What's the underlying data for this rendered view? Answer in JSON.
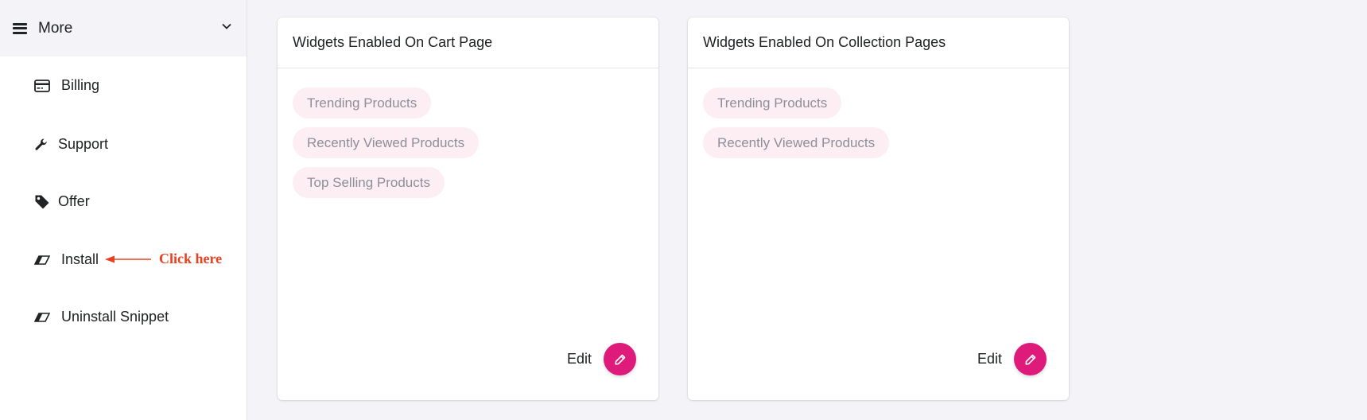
{
  "sidebar": {
    "header_label": "More",
    "items": [
      {
        "label": "Billing",
        "icon": "credit-card-icon"
      },
      {
        "label": "Support",
        "icon": "wrench-icon"
      },
      {
        "label": "Offer",
        "icon": "tag-icon"
      },
      {
        "label": "Install",
        "icon": "eraser-icon"
      },
      {
        "label": "Uninstall Snippet",
        "icon": "eraser-icon"
      }
    ]
  },
  "annotation": {
    "text": "Click here",
    "color": "#e8411f"
  },
  "cards": [
    {
      "title": "Widgets Enabled On Cart Page",
      "chips": [
        "Trending Products",
        "Recently Viewed Products",
        "Top Selling Products"
      ],
      "edit_label": "Edit"
    },
    {
      "title": "Widgets Enabled On Collection Pages",
      "chips": [
        "Trending Products",
        "Recently Viewed Products"
      ],
      "edit_label": "Edit"
    }
  ],
  "colors": {
    "accent": "#de1b7b",
    "chip_bg": "#fdeef4",
    "page_bg": "#f4f3f8"
  }
}
